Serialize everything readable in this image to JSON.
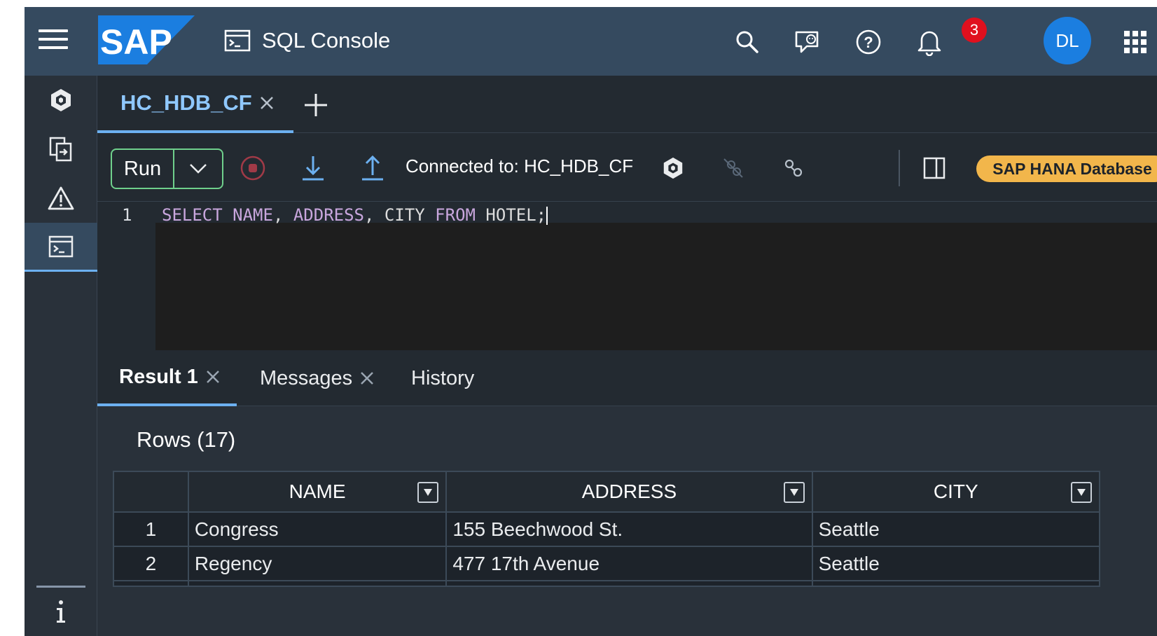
{
  "shell": {
    "logo_text": "SAP",
    "title": "SQL Console",
    "notification_count": "3",
    "user_initials": "DL",
    "icons": [
      "menu-icon",
      "search-icon",
      "feedback-icon",
      "help-icon",
      "notification-icon",
      "product-switch-icon"
    ]
  },
  "sidenav": {
    "items": [
      {
        "icon": "database-explorer-icon",
        "active": false
      },
      {
        "icon": "import-export-icon",
        "active": false
      },
      {
        "icon": "warning-icon",
        "active": false
      },
      {
        "icon": "sql-console-icon",
        "active": true
      }
    ],
    "footer_icon": "info-icon"
  },
  "editor_tabs": [
    {
      "label": "HC_HDB_CF",
      "active": true
    }
  ],
  "toolbar": {
    "run_label": "Run",
    "connection_text": "Connected to: HC_HDB_CF",
    "database_label": "SAP HANA Database"
  },
  "editor": {
    "line_number": "1",
    "code": {
      "kw_select": "SELECT",
      "col1": "NAME",
      "col2": "ADDRESS",
      "col3": "CITY",
      "kw_from": "FROM",
      "table": "HOTEL;"
    }
  },
  "result_tabs": {
    "result": "Result 1",
    "messages": "Messages",
    "history": "History"
  },
  "results": {
    "rows_label": "Rows (17)",
    "columns": [
      "NAME",
      "ADDRESS",
      "CITY"
    ],
    "rows": [
      {
        "n": "1",
        "name": "Congress",
        "address": "155 Beechwood St.",
        "city": "Seattle"
      },
      {
        "n": "2",
        "name": "Regency",
        "address": "477 17th Avenue",
        "city": "Seattle"
      }
    ]
  },
  "colors": {
    "shell": "#354a5f",
    "accent": "#6cb0f0",
    "run_border": "#6fd08c",
    "db_pill": "#f2b64b",
    "badge": "#e0101e",
    "avatar": "#1b7ee0"
  }
}
